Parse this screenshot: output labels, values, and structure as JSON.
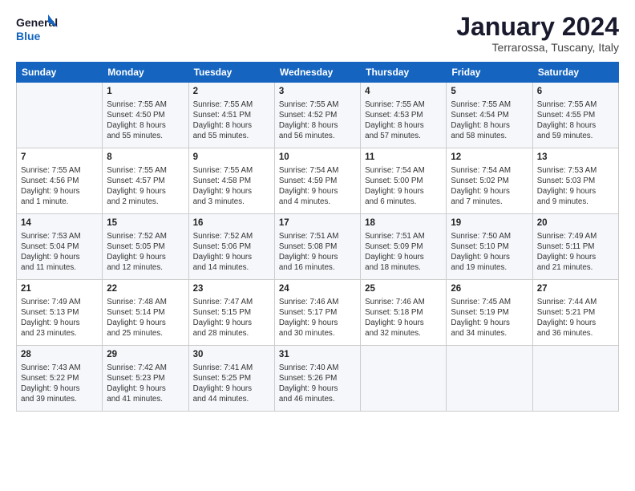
{
  "header": {
    "logo_line1": "General",
    "logo_line2": "Blue",
    "month": "January 2024",
    "location": "Terrarossa, Tuscany, Italy"
  },
  "weekdays": [
    "Sunday",
    "Monday",
    "Tuesday",
    "Wednesday",
    "Thursday",
    "Friday",
    "Saturday"
  ],
  "weeks": [
    [
      {
        "day": "",
        "info": ""
      },
      {
        "day": "1",
        "info": "Sunrise: 7:55 AM\nSunset: 4:50 PM\nDaylight: 8 hours\nand 55 minutes."
      },
      {
        "day": "2",
        "info": "Sunrise: 7:55 AM\nSunset: 4:51 PM\nDaylight: 8 hours\nand 55 minutes."
      },
      {
        "day": "3",
        "info": "Sunrise: 7:55 AM\nSunset: 4:52 PM\nDaylight: 8 hours\nand 56 minutes."
      },
      {
        "day": "4",
        "info": "Sunrise: 7:55 AM\nSunset: 4:53 PM\nDaylight: 8 hours\nand 57 minutes."
      },
      {
        "day": "5",
        "info": "Sunrise: 7:55 AM\nSunset: 4:54 PM\nDaylight: 8 hours\nand 58 minutes."
      },
      {
        "day": "6",
        "info": "Sunrise: 7:55 AM\nSunset: 4:55 PM\nDaylight: 8 hours\nand 59 minutes."
      }
    ],
    [
      {
        "day": "7",
        "info": "Sunrise: 7:55 AM\nSunset: 4:56 PM\nDaylight: 9 hours\nand 1 minute."
      },
      {
        "day": "8",
        "info": "Sunrise: 7:55 AM\nSunset: 4:57 PM\nDaylight: 9 hours\nand 2 minutes."
      },
      {
        "day": "9",
        "info": "Sunrise: 7:55 AM\nSunset: 4:58 PM\nDaylight: 9 hours\nand 3 minutes."
      },
      {
        "day": "10",
        "info": "Sunrise: 7:54 AM\nSunset: 4:59 PM\nDaylight: 9 hours\nand 4 minutes."
      },
      {
        "day": "11",
        "info": "Sunrise: 7:54 AM\nSunset: 5:00 PM\nDaylight: 9 hours\nand 6 minutes."
      },
      {
        "day": "12",
        "info": "Sunrise: 7:54 AM\nSunset: 5:02 PM\nDaylight: 9 hours\nand 7 minutes."
      },
      {
        "day": "13",
        "info": "Sunrise: 7:53 AM\nSunset: 5:03 PM\nDaylight: 9 hours\nand 9 minutes."
      }
    ],
    [
      {
        "day": "14",
        "info": "Sunrise: 7:53 AM\nSunset: 5:04 PM\nDaylight: 9 hours\nand 11 minutes."
      },
      {
        "day": "15",
        "info": "Sunrise: 7:52 AM\nSunset: 5:05 PM\nDaylight: 9 hours\nand 12 minutes."
      },
      {
        "day": "16",
        "info": "Sunrise: 7:52 AM\nSunset: 5:06 PM\nDaylight: 9 hours\nand 14 minutes."
      },
      {
        "day": "17",
        "info": "Sunrise: 7:51 AM\nSunset: 5:08 PM\nDaylight: 9 hours\nand 16 minutes."
      },
      {
        "day": "18",
        "info": "Sunrise: 7:51 AM\nSunset: 5:09 PM\nDaylight: 9 hours\nand 18 minutes."
      },
      {
        "day": "19",
        "info": "Sunrise: 7:50 AM\nSunset: 5:10 PM\nDaylight: 9 hours\nand 19 minutes."
      },
      {
        "day": "20",
        "info": "Sunrise: 7:49 AM\nSunset: 5:11 PM\nDaylight: 9 hours\nand 21 minutes."
      }
    ],
    [
      {
        "day": "21",
        "info": "Sunrise: 7:49 AM\nSunset: 5:13 PM\nDaylight: 9 hours\nand 23 minutes."
      },
      {
        "day": "22",
        "info": "Sunrise: 7:48 AM\nSunset: 5:14 PM\nDaylight: 9 hours\nand 25 minutes."
      },
      {
        "day": "23",
        "info": "Sunrise: 7:47 AM\nSunset: 5:15 PM\nDaylight: 9 hours\nand 28 minutes."
      },
      {
        "day": "24",
        "info": "Sunrise: 7:46 AM\nSunset: 5:17 PM\nDaylight: 9 hours\nand 30 minutes."
      },
      {
        "day": "25",
        "info": "Sunrise: 7:46 AM\nSunset: 5:18 PM\nDaylight: 9 hours\nand 32 minutes."
      },
      {
        "day": "26",
        "info": "Sunrise: 7:45 AM\nSunset: 5:19 PM\nDaylight: 9 hours\nand 34 minutes."
      },
      {
        "day": "27",
        "info": "Sunrise: 7:44 AM\nSunset: 5:21 PM\nDaylight: 9 hours\nand 36 minutes."
      }
    ],
    [
      {
        "day": "28",
        "info": "Sunrise: 7:43 AM\nSunset: 5:22 PM\nDaylight: 9 hours\nand 39 minutes."
      },
      {
        "day": "29",
        "info": "Sunrise: 7:42 AM\nSunset: 5:23 PM\nDaylight: 9 hours\nand 41 minutes."
      },
      {
        "day": "30",
        "info": "Sunrise: 7:41 AM\nSunset: 5:25 PM\nDaylight: 9 hours\nand 44 minutes."
      },
      {
        "day": "31",
        "info": "Sunrise: 7:40 AM\nSunset: 5:26 PM\nDaylight: 9 hours\nand 46 minutes."
      },
      {
        "day": "",
        "info": ""
      },
      {
        "day": "",
        "info": ""
      },
      {
        "day": "",
        "info": ""
      }
    ]
  ]
}
